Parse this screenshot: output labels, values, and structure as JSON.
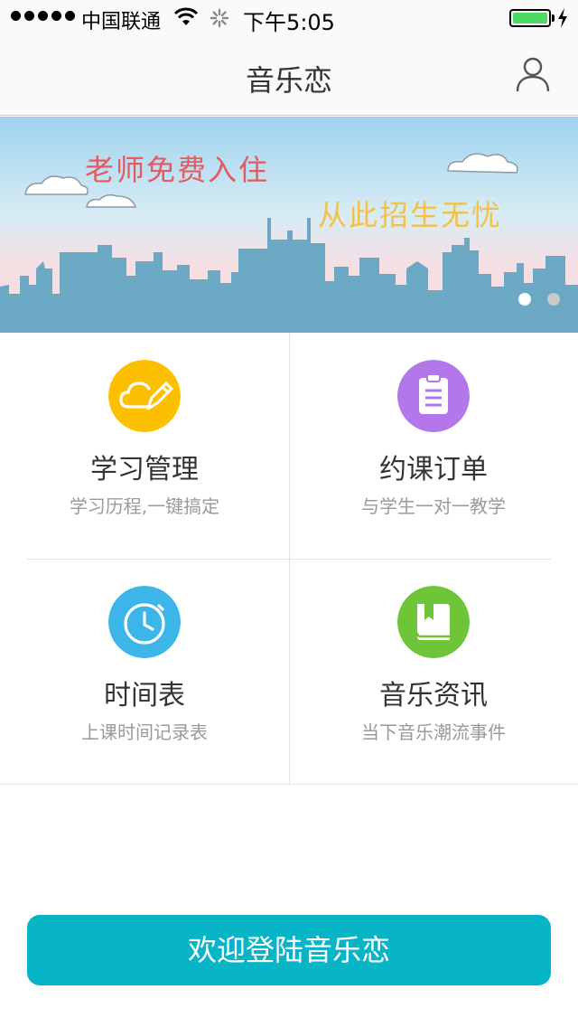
{
  "status_bar": {
    "carrier": "中国联通",
    "time": "下午5:05",
    "battery_level": 1.0,
    "battery_color": "#4cd964"
  },
  "nav": {
    "title": "音乐恋",
    "user_icon": "user-icon"
  },
  "banner": {
    "line1": "老师免费入住",
    "line2": "从此招生无忧",
    "line1_color": "#e45a5e",
    "line2_color": "#f3c14a",
    "slides": 2,
    "active_slide": 1
  },
  "grid": [
    {
      "title": "学习管理",
      "subtitle": "学习历程,一键搞定",
      "icon": "pencil-cloud-icon",
      "color": "#fdc000"
    },
    {
      "title": "约课订单",
      "subtitle": "与学生一对一教学",
      "icon": "clipboard-icon",
      "color": "#b277e8"
    },
    {
      "title": "时间表",
      "subtitle": "上课时间记录表",
      "icon": "stopwatch-icon",
      "color": "#3cb6e8"
    },
    {
      "title": "音乐资讯",
      "subtitle": "当下音乐潮流事件",
      "icon": "book-icon",
      "color": "#6ec538"
    }
  ],
  "login": {
    "label": "欢迎登陆音乐恋",
    "color": "#08b5c7"
  }
}
